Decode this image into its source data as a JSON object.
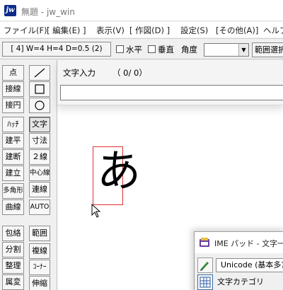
{
  "window": {
    "title": "無題 - jw_win",
    "app_icon_text": "jw"
  },
  "menu": [
    "ファイル(F)",
    "[ 編集(E) ]",
    "表示(V)",
    "[ 作図(D) ]",
    "設定(S)",
    "[その他(A)]",
    "ヘルプ"
  ],
  "toolbar": {
    "layer_button": "[ 4]  W=4  H=4  D=0.5 (2)",
    "horizontal_label": "水平",
    "vertical_label": "垂直",
    "angle_label": "角度",
    "angle_value": "",
    "range_button": "範囲選択"
  },
  "tools": {
    "left": [
      "点",
      "接線",
      "接円",
      "ﾊｯﾁ",
      "建平",
      "建断",
      "建立",
      "多角形",
      "曲線",
      "包絡",
      "分割",
      "整理",
      "属変"
    ],
    "right_shapes": [
      "line-icon",
      "rectangle-icon",
      "circle-icon"
    ],
    "right": [
      "文字",
      "寸法",
      "２線",
      "中心線",
      "連線",
      "AUTO",
      "範囲",
      "複線",
      "ｺｰﾅｰ",
      "伸縮"
    ],
    "active": "文字"
  },
  "text_input": {
    "label": "文字入力",
    "count": "（  0/   0）",
    "value": ""
  },
  "canvas": {
    "glyph": "あ"
  },
  "ime_pad": {
    "title": "IME パッド - 文字一覧",
    "charset": "Unicode (基本多言語面)",
    "category_label": "文字カテゴリ"
  }
}
